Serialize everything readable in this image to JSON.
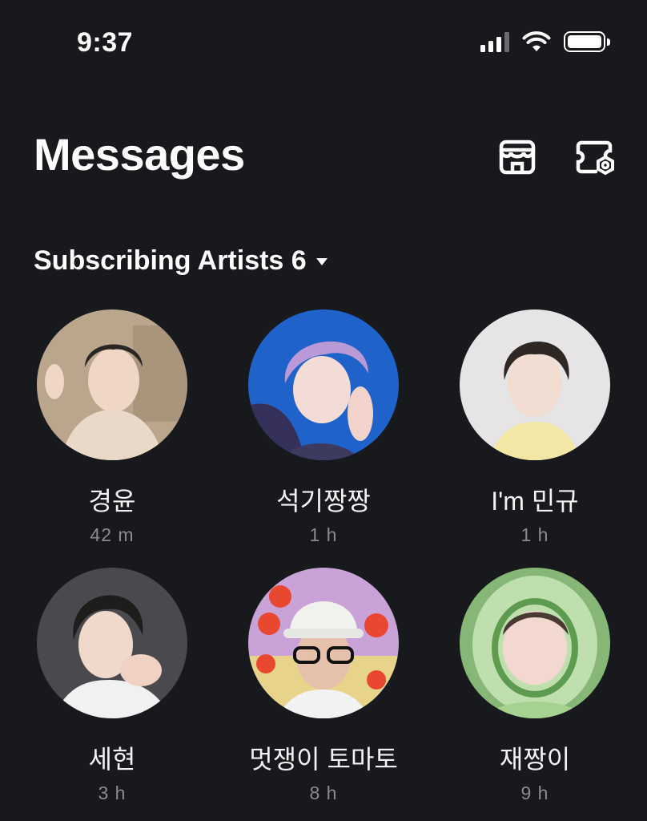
{
  "status_bar": {
    "time": "9:37"
  },
  "header": {
    "title": "Messages"
  },
  "section": {
    "title": "Subscribing Artists 6"
  },
  "artists": [
    {
      "name": "경윤",
      "time": "42 m",
      "bg": "#b9a68c",
      "accent": "#e9d9c8"
    },
    {
      "name": "석기짱짱",
      "time": "1 h",
      "bg": "#1f62c9",
      "accent": "#b99ad6"
    },
    {
      "name": "I'm 민규",
      "time": "1 h",
      "bg": "#e7e4e6",
      "accent": "#f3e7a6"
    },
    {
      "name": "세현",
      "time": "3 h",
      "bg": "#4a4a4e",
      "accent": "#f1f1f1"
    },
    {
      "name": "멋쟁이 토마토",
      "time": "8 h",
      "bg": "#c9a3d8",
      "accent": "#e8482f"
    },
    {
      "name": "재짱이",
      "time": "9 h",
      "bg": "#86b776",
      "accent": "#c9e6b8"
    }
  ],
  "colors": {
    "background": "#18191d",
    "text": "#ffffff",
    "subtext": "#8a8b90"
  }
}
